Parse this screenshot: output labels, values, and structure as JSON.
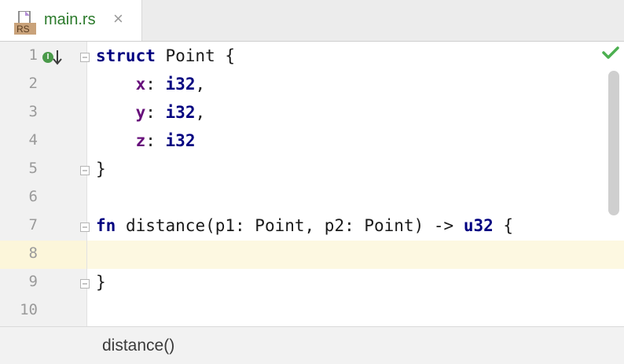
{
  "tab": {
    "icon_label": "RS",
    "title": "main.rs",
    "close_symbol": "×"
  },
  "editor": {
    "line_numbers": [
      "1",
      "2",
      "3",
      "4",
      "5",
      "6",
      "7",
      "8",
      "9",
      "10"
    ],
    "gutter_icons": {
      "implemented_marker": "I"
    },
    "code_lines": [
      {
        "kw": "struct",
        "rest": " Point {"
      },
      {
        "field": "x",
        "rest": ": ",
        "type": "i32",
        "tail": ","
      },
      {
        "field": "y",
        "rest": ": ",
        "type": "i32",
        "tail": ","
      },
      {
        "field": "z",
        "rest": ": ",
        "type": "i32",
        "tail": ""
      },
      {
        "rest": "}"
      },
      {
        "rest": ""
      },
      {
        "kw": "fn",
        "rest": " distance(p1: Point, p2: Point) -> ",
        "type": "u32",
        "tail": " {"
      },
      {
        "rest": ""
      },
      {
        "rest": "}"
      },
      {
        "rest": ""
      }
    ]
  },
  "breadcrumb": {
    "text": "distance()"
  },
  "colors": {
    "keyword": "#000080",
    "field": "#660e7a",
    "tab_title": "#2b7a2b",
    "current_line": "#fdf8e1",
    "check": "#4caf50"
  },
  "icons": [
    "rust-file-icon",
    "close-icon",
    "implemented-icon",
    "arrow-down-icon",
    "fold-icon",
    "check-icon"
  ]
}
